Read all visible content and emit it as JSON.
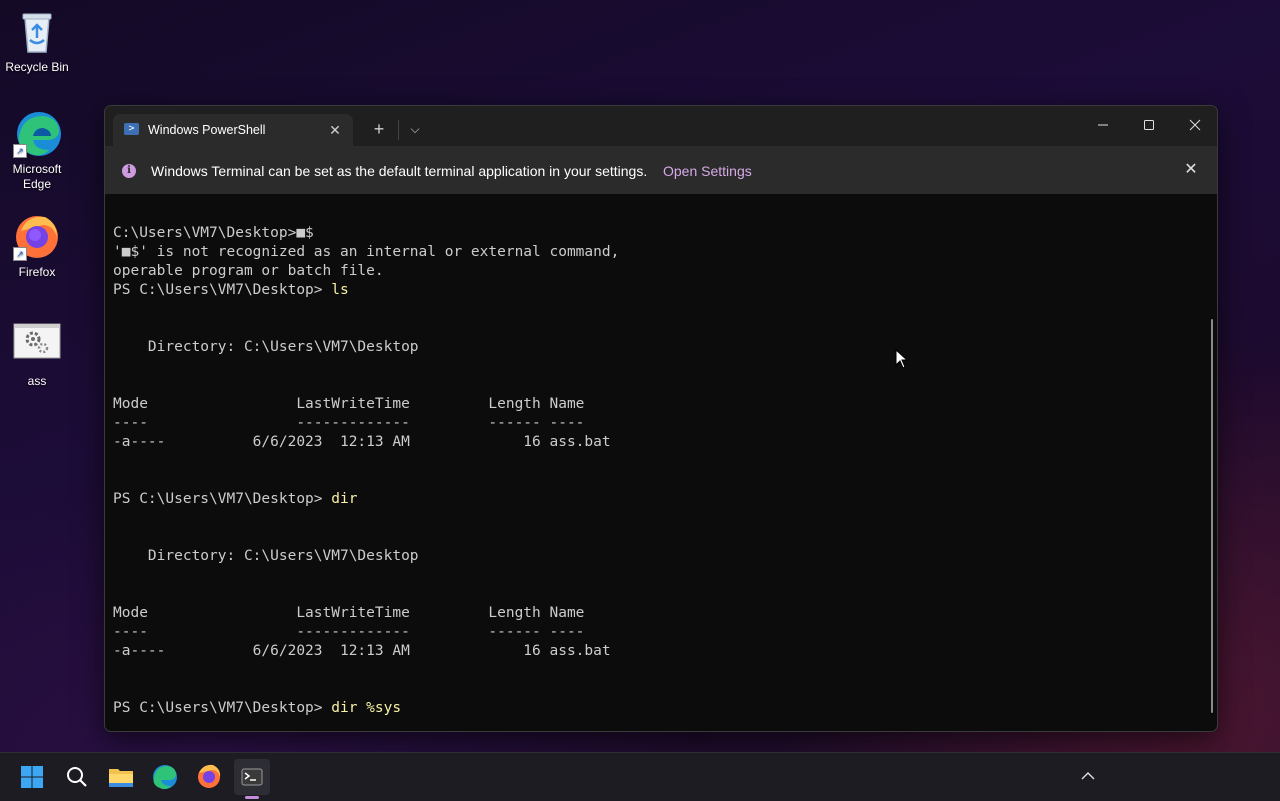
{
  "desktop": {
    "icons": [
      {
        "label": "Recycle Bin",
        "icon": "recycle-bin-icon"
      },
      {
        "label": "Microsoft Edge",
        "icon": "edge-icon"
      },
      {
        "label": "Firefox",
        "icon": "firefox-icon"
      },
      {
        "label": "ass",
        "icon": "batch-file-icon"
      }
    ]
  },
  "terminal": {
    "tab_title": "Windows PowerShell",
    "new_tab_symbol": "+",
    "dropdown_symbol": "⌵",
    "infobar": {
      "message": "Windows Terminal can be set as the default terminal application in your settings.",
      "link": "Open Settings"
    },
    "lines": [
      {
        "text": "C:\\Users\\VM7\\Desktop>■$"
      },
      {
        "text": "'■$' is not recognized as an internal or external command,"
      },
      {
        "text": "operable program or batch file."
      },
      {
        "prompt": "PS C:\\Users\\VM7\\Desktop> ",
        "cmd": "ls"
      },
      {
        "text": ""
      },
      {
        "text": ""
      },
      {
        "text": "    Directory: C:\\Users\\VM7\\Desktop"
      },
      {
        "text": ""
      },
      {
        "text": ""
      },
      {
        "text": "Mode                 LastWriteTime         Length Name"
      },
      {
        "text": "----                 -------------         ------ ----"
      },
      {
        "text": "-a----          6/6/2023  12:13 AM             16 ass.bat"
      },
      {
        "text": ""
      },
      {
        "text": ""
      },
      {
        "prompt": "PS C:\\Users\\VM7\\Desktop> ",
        "cmd": "dir"
      },
      {
        "text": ""
      },
      {
        "text": ""
      },
      {
        "text": "    Directory: C:\\Users\\VM7\\Desktop"
      },
      {
        "text": ""
      },
      {
        "text": ""
      },
      {
        "text": "Mode                 LastWriteTime         Length Name"
      },
      {
        "text": "----                 -------------         ------ ----"
      },
      {
        "text": "-a----          6/6/2023  12:13 AM             16 ass.bat"
      },
      {
        "text": ""
      },
      {
        "text": ""
      },
      {
        "prompt": "PS C:\\Users\\VM7\\Desktop> ",
        "cmd": "dir %sys"
      }
    ]
  },
  "taskbar": {
    "apps": [
      "start-icon",
      "search-icon",
      "file-explorer-icon",
      "edge-icon",
      "firefox-icon",
      "terminal-icon"
    ],
    "active_app": "terminal-icon"
  },
  "colors": {
    "console_bg": "#0c0c0c",
    "console_text": "#cccccc",
    "command_text": "#f9f1a5",
    "accent": "#c38fdc"
  }
}
